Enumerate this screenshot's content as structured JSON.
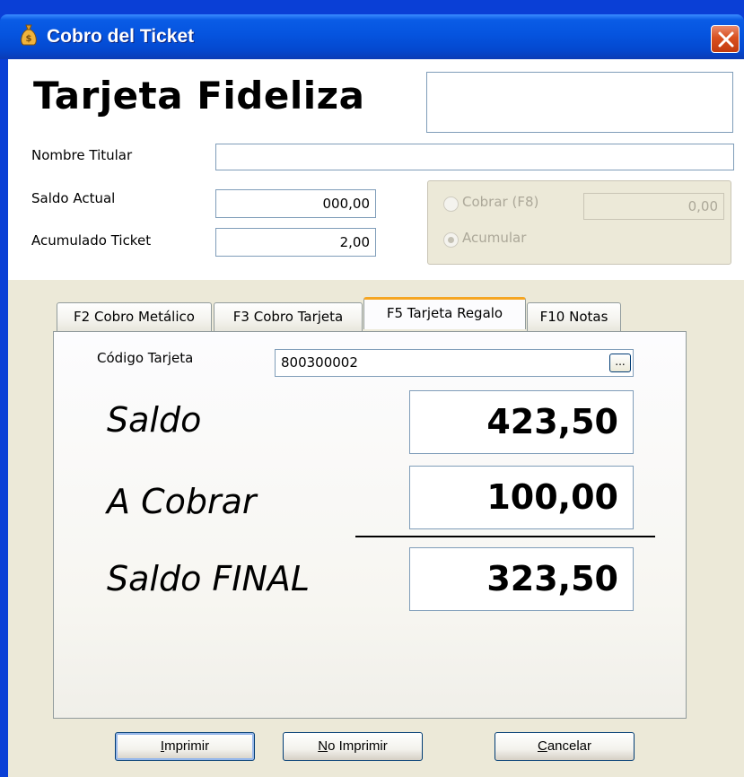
{
  "window": {
    "title": "Cobro del Ticket",
    "title_icon": "money-bag-icon",
    "close_icon": "close-icon"
  },
  "header": {
    "heading": "Tarjeta Fideliza",
    "top_box_value": ""
  },
  "fields": {
    "nombre_titular": {
      "label": "Nombre Titular",
      "value": ""
    },
    "saldo_actual": {
      "label": "Saldo Actual",
      "value": "000,00"
    },
    "acumulado_ticket": {
      "label": "Acumulado Ticket",
      "value": "2,00"
    }
  },
  "options": {
    "cobrar": {
      "label": "Cobrar (F8)",
      "selected": false
    },
    "acumular": {
      "label": "Acumular",
      "selected": true
    },
    "cobrar_value": "0,00"
  },
  "tabs": [
    {
      "label": "F2 Cobro Metálico",
      "active": false
    },
    {
      "label": "F3 Cobro Tarjeta",
      "active": false
    },
    {
      "label": "F5 Tarjeta Regalo",
      "active": true
    },
    {
      "label": "F10 Notas",
      "active": false
    }
  ],
  "tarjeta_regalo": {
    "codigo_label": "Código Tarjeta",
    "codigo_value": "800300002",
    "browse_label": "...",
    "saldo_label": "Saldo",
    "saldo_value": "423,50",
    "cobrar_label": "A Cobrar",
    "cobrar_value": "100,00",
    "final_label": "Saldo FINAL",
    "final_value": "323,50"
  },
  "buttons": {
    "imprimir": {
      "mnemonic": "I",
      "rest": "mprimir"
    },
    "no_imprimir": {
      "mnemonic": "N",
      "rest": "o Imprimir"
    },
    "cancelar": {
      "mnemonic": "C",
      "rest": "ancelar"
    }
  },
  "colors": {
    "titlebar": "#0554df",
    "panel": "#ece9d8",
    "tab_accent": "#f5a623",
    "close": "#d9501f"
  }
}
